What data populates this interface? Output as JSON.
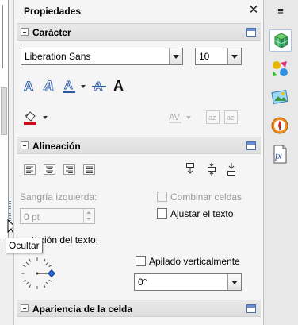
{
  "panel": {
    "title": "Propiedades",
    "close_glyph": "✕"
  },
  "sections": {
    "character": {
      "title": "Carácter"
    },
    "alignment": {
      "title": "Alineación"
    },
    "cell_appearance": {
      "title": "Apariencia de la celda"
    }
  },
  "character": {
    "font_name": "Liberation Sans",
    "font_size": "10"
  },
  "alignment": {
    "left_indent_label": "Sangría izquierda:",
    "left_indent_value": "0 pt",
    "merge_cells_label": "Combinar celdas",
    "wrap_text_label": "Ajustar el texto",
    "text_orientation_label": "tación del texto:",
    "stacked_vertically_label": "Apilado verticalmente",
    "rotation_value": "0°"
  },
  "tooltip": {
    "text": "Ocultar"
  },
  "tabbar": {
    "menu_glyph": "≡",
    "tabs": [
      "properties-tab",
      "styles-tab",
      "gallery-tab",
      "navigator-tab",
      "functions-tab"
    ]
  },
  "colors": {
    "accent": "#4a6fb0",
    "background": "#f5f5f5",
    "section_header": "#e2e2e2"
  }
}
